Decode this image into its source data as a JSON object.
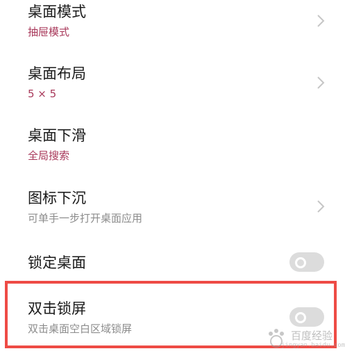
{
  "colors": {
    "accent_subtitle": "#a8385a",
    "gray_subtitle": "#8c8c8c",
    "title_text": "#1a1a1a",
    "chevron": "#c6c6c6",
    "toggle_bg": "#dcdcdc",
    "toggle_knob": "#ffffff",
    "highlight_border": "#ee4b45"
  },
  "settings": {
    "desktop_mode": {
      "title": "桌面模式",
      "value": "抽屉模式",
      "icon": "chevron-right-icon"
    },
    "desktop_layout": {
      "title": "桌面布局",
      "value": "5 × 5",
      "icon": "chevron-right-icon"
    },
    "desktop_swipe_down": {
      "title": "桌面下滑",
      "value": "全局搜索"
    },
    "icon_sink": {
      "title": "图标下沉",
      "description": "可单手一步打开桌面应用",
      "icon": "chevron-right-icon"
    },
    "lock_desktop": {
      "title": "锁定桌面",
      "enabled": false
    },
    "double_tap_lock": {
      "title": "双击锁屏",
      "description": "双击桌面空白区域锁屏",
      "enabled": false
    }
  },
  "watermark": {
    "text": "百度经验",
    "sub": "jingyan.baidu.com"
  }
}
